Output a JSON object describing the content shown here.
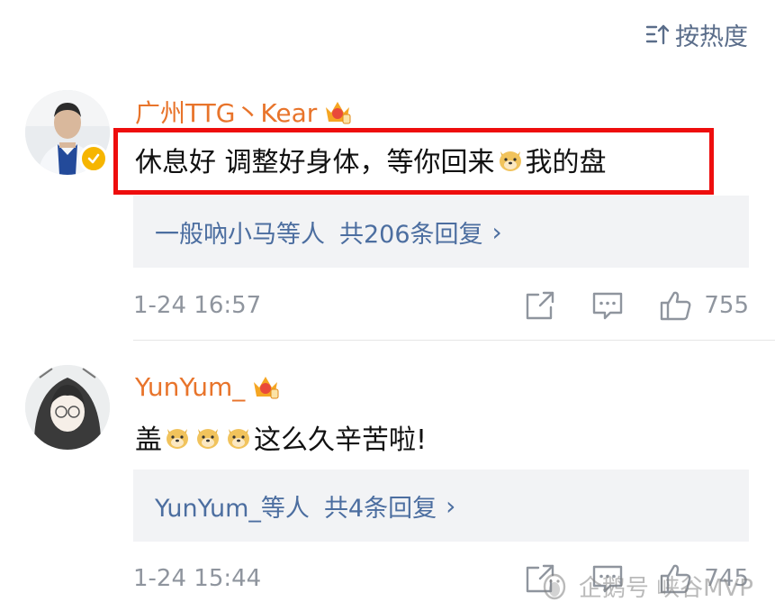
{
  "sort": {
    "label": "按热度",
    "icon": "sort-icon"
  },
  "comments": [
    {
      "username": "广州TTG丶Kear",
      "text_before": "休息好 调整好身体，等你回来",
      "text_after": "我的盘",
      "reply_names": "一般吶小马等人",
      "reply_count": "共206条回复",
      "reply_chevron": "›",
      "time": "1-24 16:57",
      "likes": "755"
    },
    {
      "username": "YunYum_",
      "text_before": "盖",
      "text_after": "这么久辛苦啦!",
      "reply_names": "YunYum_等人",
      "reply_count": "共4条回复",
      "reply_chevron": "›",
      "time": "1-24 15:44",
      "likes": "745"
    }
  ],
  "watermark": {
    "text": "企鹅号 峡谷MVP"
  },
  "colors": {
    "accent_name": "#e8742b",
    "link": "#4c6ea0",
    "meta": "#8f959e",
    "highlight": "#ee0d0d"
  }
}
